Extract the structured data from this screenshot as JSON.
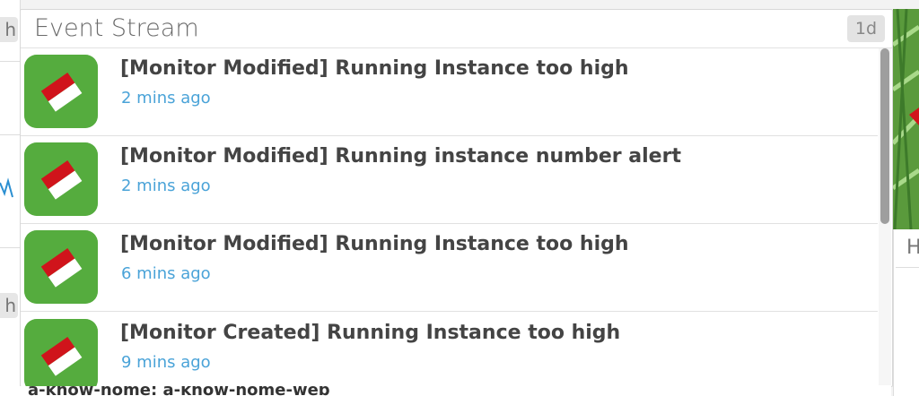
{
  "left_widget": {
    "tags": [
      "h",
      "h"
    ]
  },
  "panel": {
    "title": "Event Stream",
    "range_label": "1d"
  },
  "events": [
    {
      "title": "[Monitor Modified] Running Instance too high",
      "time": "2 mins ago",
      "icon": "monitor-flag-icon"
    },
    {
      "title": "[Monitor Modified] Running instance number alert",
      "time": "2 mins ago",
      "icon": "monitor-flag-icon"
    },
    {
      "title": "[Monitor Modified] Running Instance too high",
      "time": "6 mins ago",
      "icon": "monitor-flag-icon"
    },
    {
      "title": "[Monitor Created] Running Instance too high",
      "time": "9 mins ago",
      "icon": "monitor-flag-icon"
    }
  ],
  "bottom_strip": {
    "text": "a-know-home: a-know-home-web"
  },
  "right_widget": {
    "letter": "H"
  },
  "colors": {
    "time_link": "#4aa3d8",
    "avatar_green": "#4fa43a",
    "flag_red": "#d0141b"
  }
}
